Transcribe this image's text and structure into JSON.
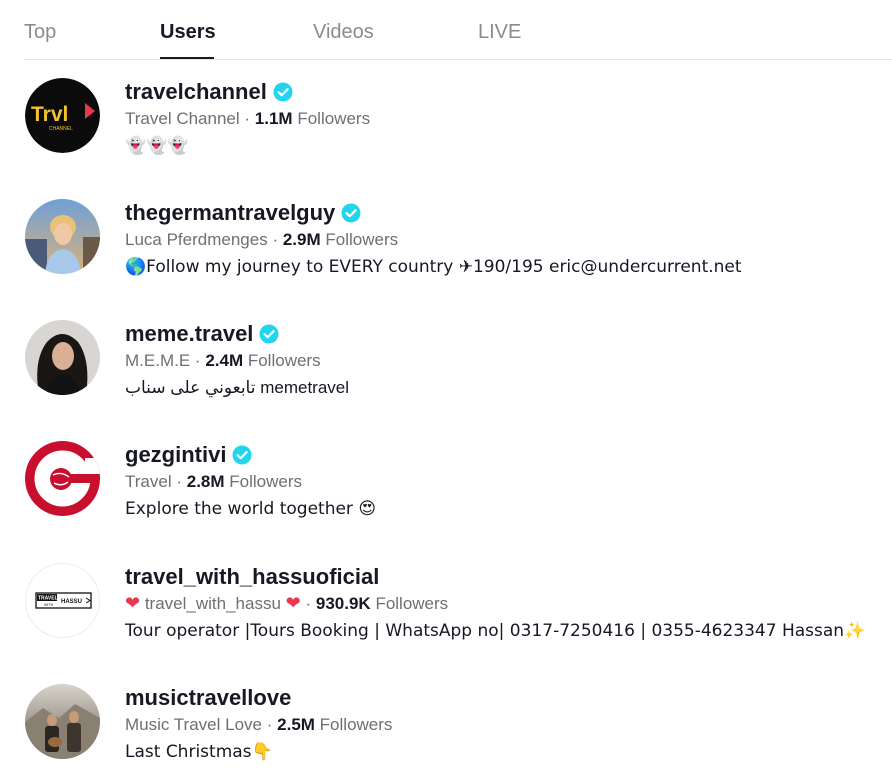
{
  "tabs": [
    {
      "label": "Top"
    },
    {
      "label": "Users"
    },
    {
      "label": "Videos"
    },
    {
      "label": "LIVE"
    }
  ],
  "active_tab": "Users",
  "users": [
    {
      "username": "travelchannel",
      "nickname": "Travel Channel",
      "separator": "·",
      "followers": "1.1M",
      "followers_label": "Followers",
      "bio": "👻👻👻",
      "avatar_text": "Trvl",
      "avatar_subtext": "CHANNEL"
    },
    {
      "username": "thegermantravelguy",
      "nickname": "Luca Pferdmenges",
      "separator": "·",
      "followers": "2.9M",
      "followers_label": "Followers",
      "bio": "🌎Follow my journey to EVERY country ✈190/195 eric@undercurrent.net"
    },
    {
      "username": "meme.travel",
      "nickname": "M.E.M.E",
      "separator": "·",
      "followers": "2.4M",
      "followers_label": "Followers",
      "bio": "تابعوني على سناب memetravel"
    },
    {
      "username": "gezgintivi",
      "nickname": "Travel",
      "separator": "·",
      "followers": "2.8M",
      "followers_label": "Followers",
      "bio": "Explore the world together 😍"
    },
    {
      "username": "travel_with_hassuoficial",
      "heart_left": "❤",
      "nickname": "travel_with_hassu",
      "heart_right": "❤",
      "separator": "·",
      "followers": "930.9K",
      "followers_label": "Followers",
      "bio": "Tour operator |Tours Booking | WhatsApp no| 0317-7250416 | 0355-4623347 Hassan✨",
      "avatar_text_1": "TRAVEL",
      "avatar_text_2": "HASSU",
      "avatar_text_3": "WITH"
    },
    {
      "username": "musictravellove",
      "nickname": "Music Travel Love",
      "separator": "·",
      "followers": "2.5M",
      "followers_label": "Followers",
      "bio": "Last Christmas👇"
    }
  ],
  "colors": {
    "verified": "#20d5ec",
    "text_primary": "#161823",
    "text_secondary": "#6e6f75",
    "tab_inactive": "#8a8b91",
    "heart": "#e8374e"
  }
}
